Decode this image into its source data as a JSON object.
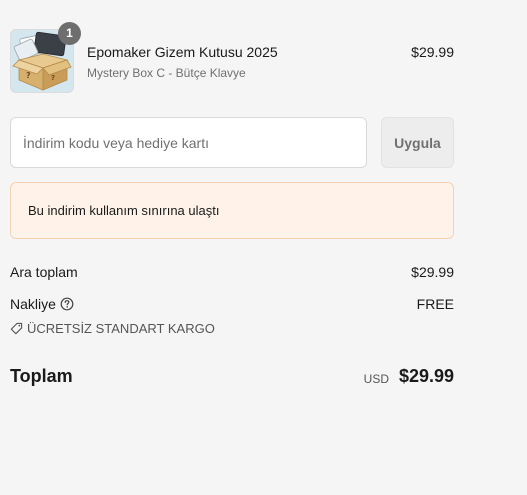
{
  "item": {
    "quantity": "1",
    "name": "Epomaker Gizem Kutusu 2025",
    "variant": "Mystery Box C - Bütçe Klavye",
    "price": "$29.99"
  },
  "discount": {
    "placeholder": "İndirim kodu veya hediye kartı",
    "value": "",
    "apply_label": "Uygula",
    "notice": "Bu indirim kullanım sınırına ulaştı"
  },
  "summary": {
    "subtotal_label": "Ara toplam",
    "subtotal_value": "$29.99",
    "shipping_label": "Nakliye",
    "shipping_value": "FREE",
    "shipping_method": "ÜCRETSİZ STANDART KARGO",
    "total_label": "Toplam",
    "currency": "USD",
    "total_value": "$29.99"
  },
  "icons": {
    "help": "question-circle-icon",
    "tag": "tag-icon"
  }
}
